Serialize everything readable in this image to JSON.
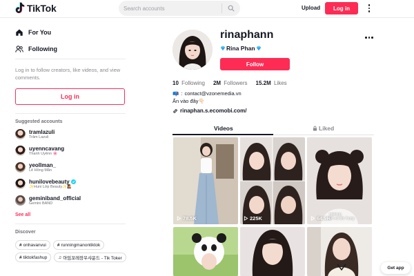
{
  "app": {
    "logo_text": "TikTok",
    "brand_color": "#fe2c55",
    "accent_cyan": "#20d5ec"
  },
  "header": {
    "search_placeholder": "Search accounts",
    "upload_label": "Upload",
    "login_label": "Log in",
    "icons": [
      "tiktok-logo-icon",
      "search-icon",
      "more-vertical-icon"
    ]
  },
  "sidebar": {
    "nav": [
      {
        "label": "For You",
        "icon": "home-icon"
      },
      {
        "label": "Following",
        "icon": "users-icon"
      }
    ],
    "login_prompt": "Log in to follow creators, like videos, and view comments.",
    "login_button": "Log in",
    "suggested_title": "Suggested accounts",
    "accounts": [
      {
        "handle": "tramlazuli",
        "name": "Trâm Lazuli",
        "verified": false
      },
      {
        "handle": "uyenncavang",
        "name": "Thanh Uyênn 🌸",
        "verified": false
      },
      {
        "handle": "yeollman_",
        "name": "Lê Hồng Mẫn",
        "verified": false
      },
      {
        "handle": "hunilovebeauty",
        "name": "✨Huni Lớp Beauty✨👩‍🎤",
        "verified": true
      },
      {
        "handle": "geminiband_official",
        "name": "Gemini BAND",
        "verified": false
      }
    ],
    "see_all": "See all",
    "discover_title": "Discover",
    "discover_tags": [
      {
        "label": "onhavanvui",
        "kind": "hashtag"
      },
      {
        "label": "runningmanontiktok",
        "kind": "hashtag"
      },
      {
        "label": "tiktokfashup",
        "kind": "hashtag"
      },
      {
        "label": "아임꼬레장우샤운드 - Tik Toker",
        "kind": "music"
      }
    ]
  },
  "profile": {
    "handle": "rinaphann",
    "display_name": "Rina Phan",
    "follow_label": "Follow",
    "stats": [
      {
        "value": "10",
        "label": "Following"
      },
      {
        "value": "2M",
        "label": "Followers"
      },
      {
        "value": "15.2M",
        "label": "Likes"
      }
    ],
    "contact": "contact@vzonemedia.vn",
    "bio": "Ấn vào đây👇🏻",
    "link": "rinaphan.s.ecomobi.com/"
  },
  "tabs": {
    "videos": "Videos",
    "liked": "Liked",
    "active": "Videos"
  },
  "videos": [
    {
      "views": "78.5K",
      "caption": ""
    },
    {
      "views": "225K",
      "caption": ""
    },
    {
      "views": "64.9K",
      "caption": "makeup\nĐồ vói đỉo Trung"
    },
    {
      "views": "",
      "caption": ""
    },
    {
      "views": "",
      "caption": ""
    },
    {
      "views": "",
      "caption": ""
    }
  ],
  "get_app": "Get app"
}
